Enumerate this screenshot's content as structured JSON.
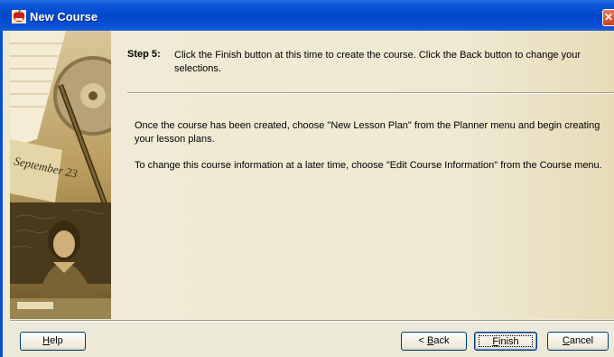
{
  "window": {
    "title": "New Course"
  },
  "step": {
    "label": "Step 5:",
    "text": "Click the Finish button at this time to create the course.  Click the Back button to change your selections."
  },
  "body": {
    "paragraph1": "Once the course has been created, choose \"New Lesson Plan\" from the Planner menu and begin creating your lesson plans.",
    "paragraph2": "To change this course information at a later time, choose \"Edit Course Information\" from the Course menu."
  },
  "side_image": {
    "calendar_text": "September 23"
  },
  "buttons": {
    "help": {
      "mnemonic": "H",
      "rest": "elp"
    },
    "back": {
      "prefix": "< ",
      "mnemonic": "B",
      "rest": "ack"
    },
    "finish": {
      "mnemonic": "F",
      "rest": "inish"
    },
    "cancel": {
      "mnemonic": "C",
      "rest": "ancel"
    }
  },
  "icons": {
    "app": "apple-icon",
    "close": "close-icon"
  },
  "colors": {
    "titlebar": "#0046c8",
    "close_button": "#c8401e",
    "dialog_bg": "#ece9d8"
  }
}
